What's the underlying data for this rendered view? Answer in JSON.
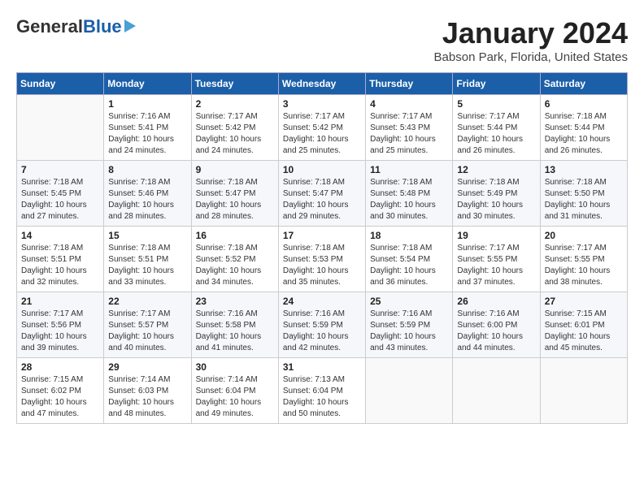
{
  "logo": {
    "general": "General",
    "blue": "Blue"
  },
  "header": {
    "month": "January 2024",
    "location": "Babson Park, Florida, United States"
  },
  "weekdays": [
    "Sunday",
    "Monday",
    "Tuesday",
    "Wednesday",
    "Thursday",
    "Friday",
    "Saturday"
  ],
  "weeks": [
    [
      {
        "day": "",
        "info": ""
      },
      {
        "day": "1",
        "info": "Sunrise: 7:16 AM\nSunset: 5:41 PM\nDaylight: 10 hours\nand 24 minutes."
      },
      {
        "day": "2",
        "info": "Sunrise: 7:17 AM\nSunset: 5:42 PM\nDaylight: 10 hours\nand 24 minutes."
      },
      {
        "day": "3",
        "info": "Sunrise: 7:17 AM\nSunset: 5:42 PM\nDaylight: 10 hours\nand 25 minutes."
      },
      {
        "day": "4",
        "info": "Sunrise: 7:17 AM\nSunset: 5:43 PM\nDaylight: 10 hours\nand 25 minutes."
      },
      {
        "day": "5",
        "info": "Sunrise: 7:17 AM\nSunset: 5:44 PM\nDaylight: 10 hours\nand 26 minutes."
      },
      {
        "day": "6",
        "info": "Sunrise: 7:18 AM\nSunset: 5:44 PM\nDaylight: 10 hours\nand 26 minutes."
      }
    ],
    [
      {
        "day": "7",
        "info": "Sunrise: 7:18 AM\nSunset: 5:45 PM\nDaylight: 10 hours\nand 27 minutes."
      },
      {
        "day": "8",
        "info": "Sunrise: 7:18 AM\nSunset: 5:46 PM\nDaylight: 10 hours\nand 28 minutes."
      },
      {
        "day": "9",
        "info": "Sunrise: 7:18 AM\nSunset: 5:47 PM\nDaylight: 10 hours\nand 28 minutes."
      },
      {
        "day": "10",
        "info": "Sunrise: 7:18 AM\nSunset: 5:47 PM\nDaylight: 10 hours\nand 29 minutes."
      },
      {
        "day": "11",
        "info": "Sunrise: 7:18 AM\nSunset: 5:48 PM\nDaylight: 10 hours\nand 30 minutes."
      },
      {
        "day": "12",
        "info": "Sunrise: 7:18 AM\nSunset: 5:49 PM\nDaylight: 10 hours\nand 30 minutes."
      },
      {
        "day": "13",
        "info": "Sunrise: 7:18 AM\nSunset: 5:50 PM\nDaylight: 10 hours\nand 31 minutes."
      }
    ],
    [
      {
        "day": "14",
        "info": "Sunrise: 7:18 AM\nSunset: 5:51 PM\nDaylight: 10 hours\nand 32 minutes."
      },
      {
        "day": "15",
        "info": "Sunrise: 7:18 AM\nSunset: 5:51 PM\nDaylight: 10 hours\nand 33 minutes."
      },
      {
        "day": "16",
        "info": "Sunrise: 7:18 AM\nSunset: 5:52 PM\nDaylight: 10 hours\nand 34 minutes."
      },
      {
        "day": "17",
        "info": "Sunrise: 7:18 AM\nSunset: 5:53 PM\nDaylight: 10 hours\nand 35 minutes."
      },
      {
        "day": "18",
        "info": "Sunrise: 7:18 AM\nSunset: 5:54 PM\nDaylight: 10 hours\nand 36 minutes."
      },
      {
        "day": "19",
        "info": "Sunrise: 7:17 AM\nSunset: 5:55 PM\nDaylight: 10 hours\nand 37 minutes."
      },
      {
        "day": "20",
        "info": "Sunrise: 7:17 AM\nSunset: 5:55 PM\nDaylight: 10 hours\nand 38 minutes."
      }
    ],
    [
      {
        "day": "21",
        "info": "Sunrise: 7:17 AM\nSunset: 5:56 PM\nDaylight: 10 hours\nand 39 minutes."
      },
      {
        "day": "22",
        "info": "Sunrise: 7:17 AM\nSunset: 5:57 PM\nDaylight: 10 hours\nand 40 minutes."
      },
      {
        "day": "23",
        "info": "Sunrise: 7:16 AM\nSunset: 5:58 PM\nDaylight: 10 hours\nand 41 minutes."
      },
      {
        "day": "24",
        "info": "Sunrise: 7:16 AM\nSunset: 5:59 PM\nDaylight: 10 hours\nand 42 minutes."
      },
      {
        "day": "25",
        "info": "Sunrise: 7:16 AM\nSunset: 5:59 PM\nDaylight: 10 hours\nand 43 minutes."
      },
      {
        "day": "26",
        "info": "Sunrise: 7:16 AM\nSunset: 6:00 PM\nDaylight: 10 hours\nand 44 minutes."
      },
      {
        "day": "27",
        "info": "Sunrise: 7:15 AM\nSunset: 6:01 PM\nDaylight: 10 hours\nand 45 minutes."
      }
    ],
    [
      {
        "day": "28",
        "info": "Sunrise: 7:15 AM\nSunset: 6:02 PM\nDaylight: 10 hours\nand 47 minutes."
      },
      {
        "day": "29",
        "info": "Sunrise: 7:14 AM\nSunset: 6:03 PM\nDaylight: 10 hours\nand 48 minutes."
      },
      {
        "day": "30",
        "info": "Sunrise: 7:14 AM\nSunset: 6:04 PM\nDaylight: 10 hours\nand 49 minutes."
      },
      {
        "day": "31",
        "info": "Sunrise: 7:13 AM\nSunset: 6:04 PM\nDaylight: 10 hours\nand 50 minutes."
      },
      {
        "day": "",
        "info": ""
      },
      {
        "day": "",
        "info": ""
      },
      {
        "day": "",
        "info": ""
      }
    ]
  ]
}
